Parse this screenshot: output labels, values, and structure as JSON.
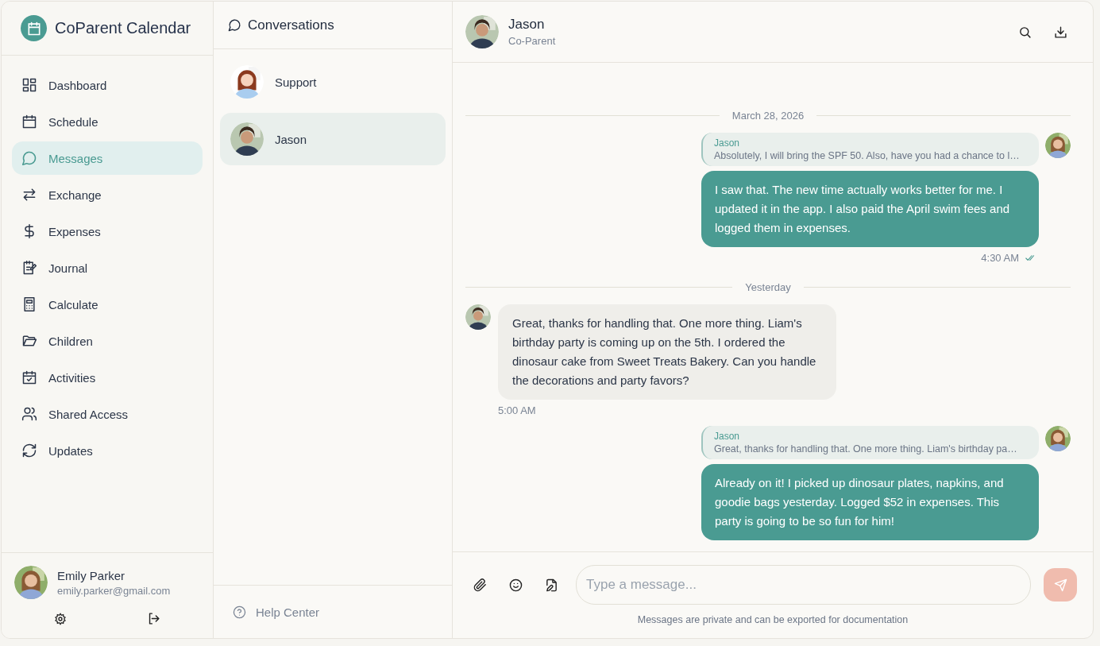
{
  "app": {
    "title": "CoParent Calendar"
  },
  "nav": [
    {
      "label": "Dashboard",
      "selected": false
    },
    {
      "label": "Schedule",
      "selected": false
    },
    {
      "label": "Messages",
      "selected": true
    },
    {
      "label": "Exchange",
      "selected": false
    },
    {
      "label": "Expenses",
      "selected": false
    },
    {
      "label": "Journal",
      "selected": false
    },
    {
      "label": "Calculate",
      "selected": false
    },
    {
      "label": "Children",
      "selected": false
    },
    {
      "label": "Activities",
      "selected": false
    },
    {
      "label": "Shared Access",
      "selected": false
    },
    {
      "label": "Updates",
      "selected": false
    }
  ],
  "user": {
    "name": "Emily Parker",
    "email": "emily.parker@gmail.com"
  },
  "conversations": {
    "title": "Conversations",
    "items": [
      {
        "name": "Support",
        "kind": "cartoon",
        "selected": false
      },
      {
        "name": "Jason",
        "selected": true
      }
    ],
    "help": "Help Center"
  },
  "chat": {
    "name": "Jason",
    "role": "Co-Parent",
    "messages": [
      {
        "kind": "divider",
        "text": "March 28, 2026"
      },
      {
        "kind": "outgoing",
        "reply": {
          "author": "Jason",
          "text": "Absolutely, I will bring the SPF 50. Also, have you had a chance to l…"
        },
        "text": "I saw that. The new time actually works better for me. I updated it in the app. I also paid the April swim fees and logged them in expenses.",
        "time": "4:30 AM",
        "read": true
      },
      {
        "kind": "divider",
        "text": "Yesterday"
      },
      {
        "kind": "incoming",
        "text": "Great, thanks for handling that. One more thing. Liam's birthday party is coming up on the 5th. I ordered the dinosaur cake from Sweet Treats Bakery. Can you handle the decorations and party favors?",
        "time": "5:00 AM"
      },
      {
        "kind": "outgoing",
        "reply": {
          "author": "Jason",
          "text": "Great, thanks for handling that. One more thing. Liam's birthday pa…"
        },
        "text": "Already on it! I picked up dinosaur plates, napkins, and goodie bags yesterday. Logged $52 in expenses. This party is going to be so fun for him!"
      }
    ],
    "composer": {
      "placeholder": "Type a message...",
      "send_disabled": true,
      "note": "Messages are private and can be exported for documentation"
    }
  }
}
